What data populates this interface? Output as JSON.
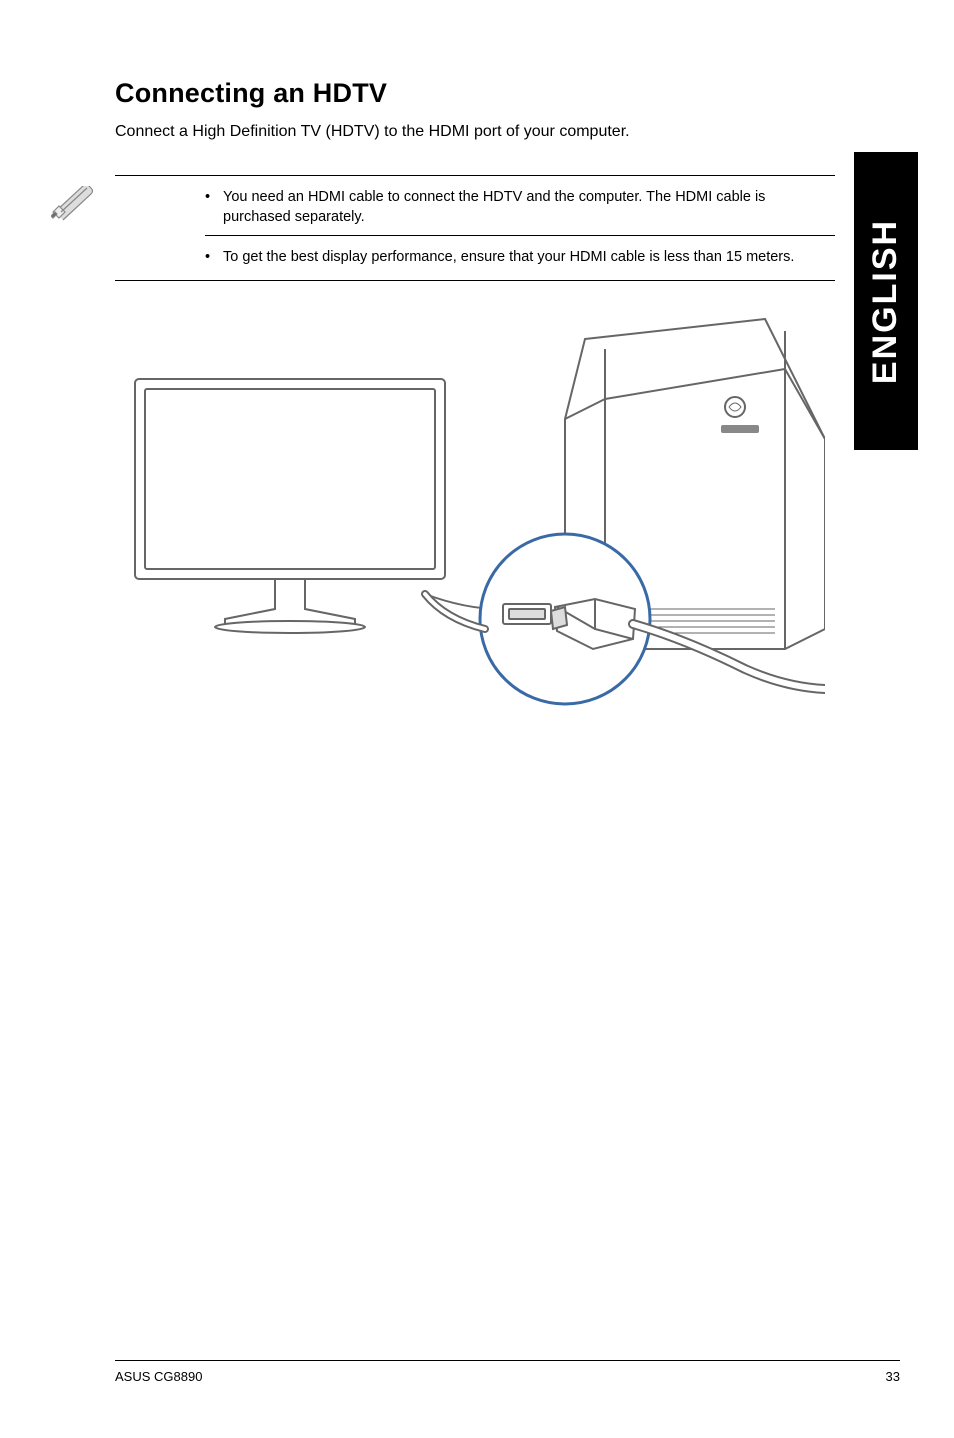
{
  "side_tab": "ENGLISH",
  "heading": "Connecting an HDTV",
  "intro": "Connect a High Definition TV (HDTV) to the HDMI port of your computer.",
  "notes": [
    "You need an HDMI cable to connect the HDTV and the computer. The HDMI cable is purchased separately.",
    "To get the best display performance, ensure that your HDMI cable is less than 15 meters."
  ],
  "footer": {
    "left": "ASUS CG8890",
    "right": "33"
  }
}
